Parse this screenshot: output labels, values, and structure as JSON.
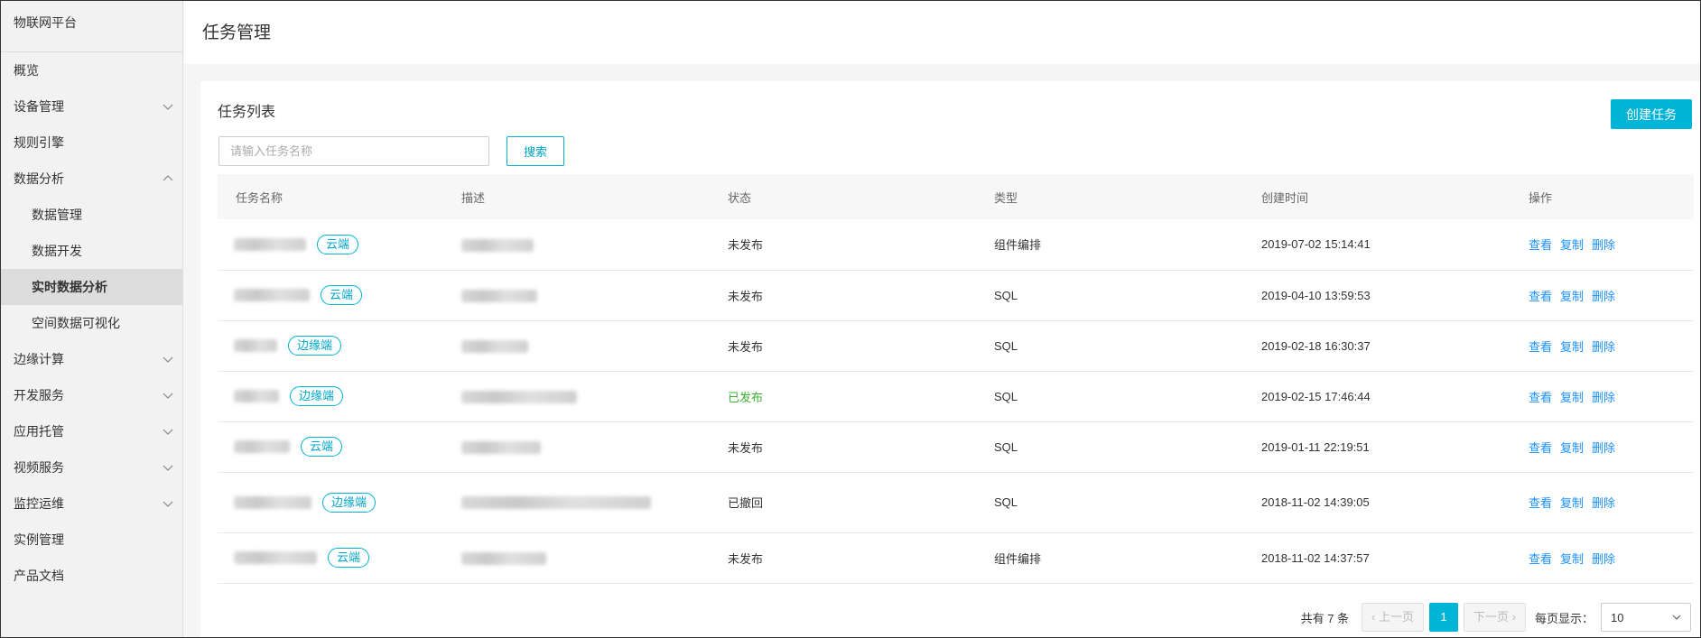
{
  "sidebar": {
    "brand": "物联网平台",
    "items": [
      {
        "label": "概览",
        "chevron": "none"
      },
      {
        "label": "设备管理",
        "chevron": "down"
      },
      {
        "label": "规则引擎",
        "chevron": "none"
      },
      {
        "label": "数据分析",
        "chevron": "up"
      },
      {
        "label": "数据管理",
        "chevron": "none",
        "sub": true
      },
      {
        "label": "数据开发",
        "chevron": "none",
        "sub": true
      },
      {
        "label": "实时数据分析",
        "chevron": "none",
        "sub": true,
        "active": true
      },
      {
        "label": "空间数据可视化",
        "chevron": "none",
        "sub": true
      },
      {
        "label": "边缘计算",
        "chevron": "down"
      },
      {
        "label": "开发服务",
        "chevron": "down"
      },
      {
        "label": "应用托管",
        "chevron": "down"
      },
      {
        "label": "视频服务",
        "chevron": "down"
      },
      {
        "label": "监控运维",
        "chevron": "down"
      },
      {
        "label": "实例管理",
        "chevron": "none"
      },
      {
        "label": "产品文档",
        "chevron": "none"
      }
    ]
  },
  "header": {
    "title": "任务管理"
  },
  "card": {
    "title": "任务列表",
    "create_label": "创建任务",
    "search_placeholder": "请输入任务名称",
    "search_label": "搜索"
  },
  "table": {
    "columns": [
      "任务名称",
      "描述",
      "状态",
      "类型",
      "创建时间",
      "操作"
    ],
    "rows": [
      {
        "tag": "云端",
        "status": "未发布",
        "type": "组件编排",
        "created": "2019-07-02 15:14:41"
      },
      {
        "tag": "云端",
        "status": "未发布",
        "type": "SQL",
        "created": "2019-04-10 13:59:53"
      },
      {
        "tag": "边缘端",
        "status": "未发布",
        "type": "SQL",
        "created": "2019-02-18 16:30:37"
      },
      {
        "tag": "边缘端",
        "status": "已发布",
        "type": "SQL",
        "created": "2019-02-15 17:46:44"
      },
      {
        "tag": "云端",
        "status": "未发布",
        "type": "SQL",
        "created": "2019-01-11 22:19:51"
      },
      {
        "tag": "边缘端",
        "status": "已撤回",
        "type": "SQL",
        "created": "2018-11-02 14:39:05"
      },
      {
        "tag": "云端",
        "status": "未发布",
        "type": "组件编排",
        "created": "2018-11-02 14:37:57"
      }
    ],
    "actions": [
      "查看",
      "复制",
      "删除"
    ]
  },
  "pagination": {
    "total": "共有 7 条",
    "prev": "上一页",
    "current": "1",
    "next": "下一页",
    "per_page_label": "每页显示：",
    "per_page": "10"
  },
  "colors": {
    "accent": "#00b4d8",
    "link": "#1a90ff",
    "published": "#3cb034"
  }
}
